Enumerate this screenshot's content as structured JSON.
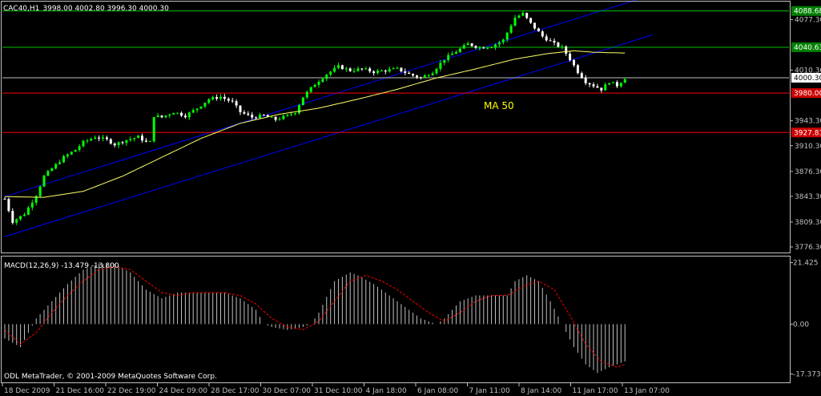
{
  "header": {
    "symbol": "CAC40,H1",
    "ohlc": "3998.00 4002.80 3996.30 4000.30"
  },
  "indicator": {
    "label": "MACD(12,26,9) -13.479 -13.800"
  },
  "copyright": "ODL MetaTrader, © 2001-2009 MetaQuotes Software Corp.",
  "colors": {
    "background": "#000000",
    "frame": "#c0c0c0",
    "grid": "#2a2a2a",
    "bull": "#00ff00",
    "bear": "#ffffff",
    "ma": "#ffff66",
    "channel": "#0000ff",
    "green_level": "#00c000",
    "red_level": "#ff0000",
    "macd_hist": "#c0c0c0",
    "macd_signal": "#ff0000",
    "ma_label": "#ffff00",
    "tag_green": "#008000",
    "tag_red": "#cc0000"
  },
  "chart_data": [
    {
      "type": "candlestick",
      "title": "CAC40,H1",
      "ylim": [
        3770,
        4100
      ],
      "yticks": [
        "4077.30",
        "4010.30",
        "3943.30",
        "3910.30",
        "3876.30",
        "3843.30",
        "3809.30",
        "3776.30"
      ],
      "ytick_values": [
        4077.3,
        4010.3,
        3943.3,
        3910.3,
        3876.3,
        3843.3,
        3809.3,
        3776.3
      ],
      "xticks": [
        "18 Dec 2009",
        "21 Dec 16:00",
        "22 Dec 19:00",
        "24 Dec 09:00",
        "28 Dec 17:00",
        "30 Dec 07:00",
        "31 Dec 10:00",
        "4 Jan 18:00",
        "6 Jan 08:00",
        "7 Jan 11:00",
        "8 Jan 14:00",
        "11 Jan 17:00",
        "13 Jan 07:00"
      ],
      "close_path": [
        [
          0,
          3840
        ],
        [
          2,
          3810
        ],
        [
          5,
          3820
        ],
        [
          8,
          3845
        ],
        [
          10,
          3870
        ],
        [
          12,
          3880
        ],
        [
          15,
          3895
        ],
        [
          18,
          3905
        ],
        [
          20,
          3915
        ],
        [
          23,
          3922
        ],
        [
          26,
          3918
        ],
        [
          28,
          3912
        ],
        [
          31,
          3918
        ],
        [
          34,
          3922
        ],
        [
          36,
          3915
        ],
        [
          37,
          3915
        ],
        [
          38,
          3950
        ],
        [
          40,
          3948
        ],
        [
          43,
          3955
        ],
        [
          46,
          3950
        ],
        [
          49,
          3960
        ],
        [
          52,
          3972
        ],
        [
          55,
          3975
        ],
        [
          58,
          3968
        ],
        [
          60,
          3955
        ],
        [
          63,
          3948
        ],
        [
          66,
          3950
        ],
        [
          69,
          3945
        ],
        [
          72,
          3950
        ],
        [
          74,
          3955
        ],
        [
          76,
          3975
        ],
        [
          79,
          3992
        ],
        [
          82,
          4005
        ],
        [
          85,
          4015
        ],
        [
          88,
          4010
        ],
        [
          91,
          4012
        ],
        [
          94,
          4008
        ],
        [
          97,
          4010
        ],
        [
          100,
          4012
        ],
        [
          103,
          4005
        ],
        [
          106,
          4000
        ],
        [
          109,
          4008
        ],
        [
          112,
          4025
        ],
        [
          115,
          4035
        ],
        [
          118,
          4045
        ],
        [
          121,
          4040
        ],
        [
          124,
          4042
        ],
        [
          127,
          4050
        ],
        [
          130,
          4080
        ],
        [
          132,
          4085
        ],
        [
          134,
          4072
        ],
        [
          137,
          4055
        ],
        [
          140,
          4045
        ],
        [
          142,
          4040
        ],
        [
          144,
          4025
        ],
        [
          146,
          4008
        ],
        [
          148,
          3995
        ],
        [
          150,
          3990
        ],
        [
          152,
          3985
        ],
        [
          154,
          3995
        ],
        [
          156,
          3990
        ],
        [
          158,
          4000
        ]
      ],
      "moving_average": {
        "label": "MA 50",
        "path": [
          [
            0,
            3843
          ],
          [
            10,
            3842
          ],
          [
            20,
            3850
          ],
          [
            30,
            3870
          ],
          [
            40,
            3895
          ],
          [
            50,
            3920
          ],
          [
            60,
            3940
          ],
          [
            70,
            3952
          ],
          [
            80,
            3960
          ],
          [
            90,
            3972
          ],
          [
            100,
            3985
          ],
          [
            110,
            4000
          ],
          [
            120,
            4012
          ],
          [
            130,
            4025
          ],
          [
            138,
            4032
          ],
          [
            145,
            4036
          ],
          [
            150,
            4034
          ],
          [
            158,
            4033
          ]
        ]
      },
      "channel_lines": [
        {
          "from": [
            0,
            3843
          ],
          "to": [
            165,
            4110
          ]
        },
        {
          "from": [
            0,
            3790
          ],
          "to": [
            165,
            4057
          ]
        }
      ],
      "horizontal_levels": [
        {
          "value": 4088.68,
          "label": "4088.68",
          "style": "green"
        },
        {
          "value": 4040.63,
          "label": "4040.63",
          "style": "green"
        },
        {
          "value": 4000.3,
          "label": "4000.30",
          "style": "current"
        },
        {
          "value": 3980.0,
          "label": "3980.00",
          "style": "red"
        },
        {
          "value": 3927.81,
          "label": "3927.81",
          "style": "red"
        }
      ]
    },
    {
      "type": "histogram",
      "title": "MACD(12,26,9)",
      "ylim": [
        -20,
        23
      ],
      "yticks": [
        "21.425",
        "0.00",
        "-17.373"
      ],
      "ytick_values": [
        21.425,
        0,
        -17.373
      ],
      "macd_path": [
        [
          0,
          -5
        ],
        [
          4,
          -8
        ],
        [
          8,
          2
        ],
        [
          12,
          8
        ],
        [
          16,
          14
        ],
        [
          20,
          19
        ],
        [
          24,
          21
        ],
        [
          28,
          21
        ],
        [
          32,
          18
        ],
        [
          36,
          12
        ],
        [
          40,
          9
        ],
        [
          44,
          11
        ],
        [
          48,
          11
        ],
        [
          52,
          11
        ],
        [
          56,
          11
        ],
        [
          60,
          9
        ],
        [
          64,
          5
        ],
        [
          66,
          0
        ],
        [
          68,
          -1
        ],
        [
          72,
          -2
        ],
        [
          76,
          -1
        ],
        [
          78,
          0
        ],
        [
          80,
          4
        ],
        [
          84,
          15
        ],
        [
          88,
          18
        ],
        [
          90,
          17
        ],
        [
          94,
          14
        ],
        [
          98,
          10
        ],
        [
          102,
          6
        ],
        [
          106,
          2
        ],
        [
          110,
          0
        ],
        [
          112,
          2
        ],
        [
          116,
          8
        ],
        [
          120,
          10
        ],
        [
          124,
          10
        ],
        [
          128,
          10
        ],
        [
          130,
          15
        ],
        [
          133,
          17
        ],
        [
          136,
          15
        ],
        [
          139,
          8
        ],
        [
          142,
          0
        ],
        [
          145,
          -8
        ],
        [
          148,
          -14
        ],
        [
          151,
          -17
        ],
        [
          154,
          -15
        ],
        [
          156,
          -14
        ],
        [
          158,
          -13
        ]
      ],
      "signal_path": [
        [
          0,
          -2
        ],
        [
          4,
          -7
        ],
        [
          8,
          -3
        ],
        [
          12,
          4
        ],
        [
          16,
          10
        ],
        [
          20,
          15
        ],
        [
          24,
          19
        ],
        [
          28,
          20
        ],
        [
          32,
          19
        ],
        [
          36,
          15
        ],
        [
          40,
          11
        ],
        [
          44,
          10
        ],
        [
          48,
          11
        ],
        [
          52,
          11
        ],
        [
          56,
          11
        ],
        [
          60,
          10
        ],
        [
          64,
          7
        ],
        [
          68,
          2
        ],
        [
          72,
          -1
        ],
        [
          76,
          -2
        ],
        [
          80,
          1
        ],
        [
          84,
          8
        ],
        [
          88,
          15
        ],
        [
          92,
          17
        ],
        [
          96,
          15
        ],
        [
          100,
          12
        ],
        [
          104,
          8
        ],
        [
          108,
          4
        ],
        [
          112,
          1
        ],
        [
          116,
          4
        ],
        [
          120,
          8
        ],
        [
          124,
          10
        ],
        [
          128,
          10
        ],
        [
          132,
          13
        ],
        [
          136,
          15
        ],
        [
          140,
          12
        ],
        [
          144,
          3
        ],
        [
          148,
          -7
        ],
        [
          152,
          -13
        ],
        [
          156,
          -15
        ],
        [
          158,
          -14
        ]
      ]
    }
  ]
}
